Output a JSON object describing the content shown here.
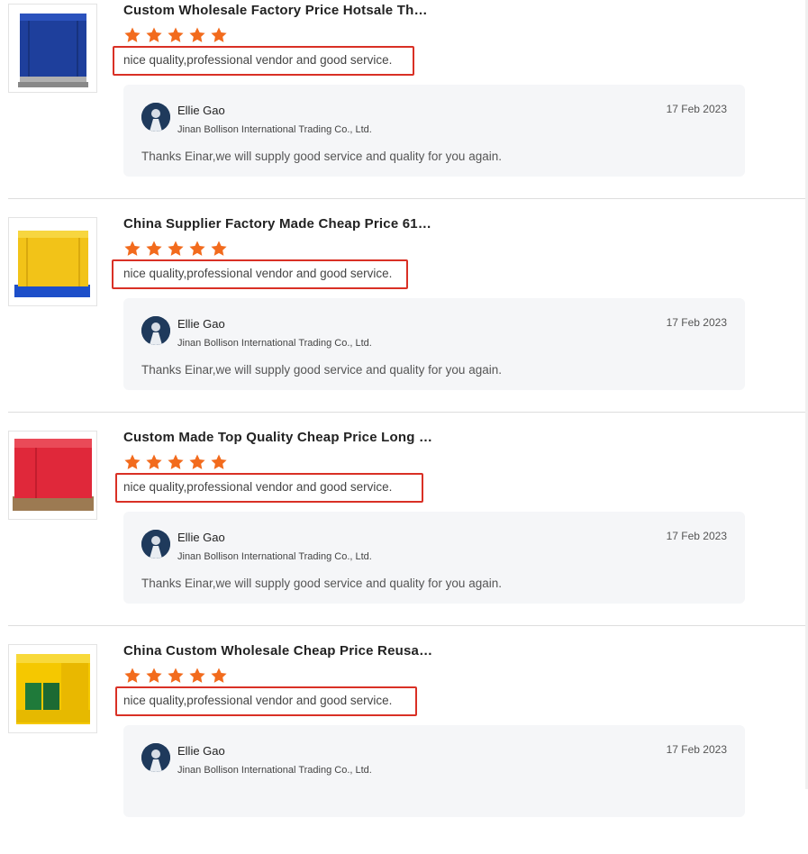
{
  "reviews": [
    {
      "product_title": "Custom Wholesale Factory Price Hotsale Ther...",
      "image_color": "#1e3f9c",
      "rating": 5,
      "comment": "nice quality,professional vendor and good service.",
      "reply": {
        "name": "Ellie Gao",
        "company": "Jinan Bollison International Trading Co., Ltd.",
        "date": "17 Feb 2023",
        "text": "Thanks Einar,we will supply good service and quality for you again."
      }
    },
    {
      "product_title": "China Supplier Factory Made Cheap Price 610g...",
      "image_color": "#f2c318",
      "rating": 5,
      "comment": "nice quality,professional vendor and good service.",
      "reply": {
        "name": "Ellie Gao",
        "company": "Jinan Bollison International Trading Co., Ltd.",
        "date": "17 Feb 2023",
        "text": "Thanks Einar,we will supply good service and quality for you again."
      }
    },
    {
      "product_title": "Custom Made Top Quality Cheap Price Long Ti...",
      "image_color": "#e0283a",
      "rating": 5,
      "comment": "nice quality,professional vendor and good service.",
      "reply": {
        "name": "Ellie Gao",
        "company": "Jinan Bollison International Trading Co., Ltd.",
        "date": "17 Feb 2023",
        "text": "Thanks Einar,we will supply good service and quality for you again."
      }
    },
    {
      "product_title": "China Custom Wholesale Cheap Price Reusabl...",
      "image_color": "#f5c800",
      "rating": 5,
      "comment": "nice quality,professional vendor and good service.",
      "reply": {
        "name": "Ellie Gao",
        "company": "Jinan Bollison International Trading Co., Ltd.",
        "date": "17 Feb 2023",
        "text": ""
      }
    }
  ],
  "colors": {
    "star": "#f26b1d",
    "highlight_border": "#d93025",
    "reply_background": "#f5f6f8"
  }
}
